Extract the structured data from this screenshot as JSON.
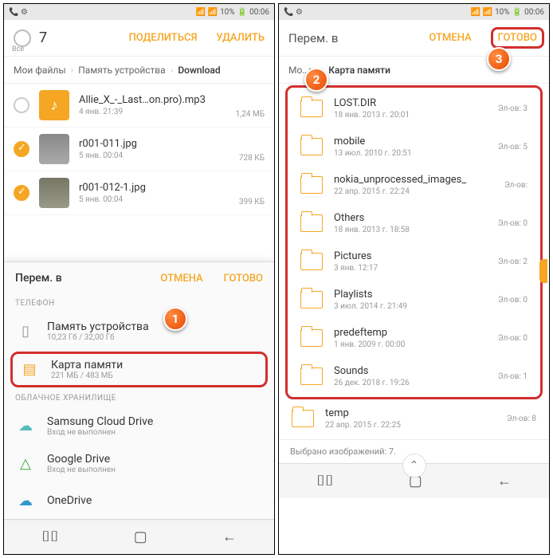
{
  "status": {
    "batt": "10%",
    "time": "00:06"
  },
  "p1": {
    "count": "7",
    "all": "Все",
    "share": "ПОДЕЛИТЬСЯ",
    "delete": "УДАЛИТЬ",
    "crumb1": "Мои файлы",
    "crumb2": "Память устройства",
    "crumb3": "Download",
    "files": [
      {
        "name": "Allie_X_-_Last…on.pro).mp3",
        "date": "4 янв. 21:39",
        "size": "1,24 МБ",
        "type": "music",
        "checked": false
      },
      {
        "name": "r001-011.jpg",
        "date": "5 янв. 00:04",
        "size": "728 КБ",
        "type": "img",
        "checked": true
      },
      {
        "name": "r001-012-1.jpg",
        "date": "5 янв. 00:04",
        "size": "399 КБ",
        "type": "img",
        "checked": true
      }
    ],
    "sheet": {
      "title": "Перем. в",
      "cancel": "ОТМЕНА",
      "done": "ГОТОВО",
      "cat1": "ТЕЛЕФОН",
      "cat2": "ОБЛАЧНОЕ ХРАНИЛИЩЕ",
      "storages": [
        {
          "name": "Память устройства",
          "sub": "10,23 Гб / 32,00 Гб",
          "icon": "▢"
        },
        {
          "name": "Карта памяти",
          "sub": "221 МБ / 483 МБ",
          "icon": "▤"
        }
      ],
      "clouds": [
        {
          "name": "Samsung Cloud Drive",
          "sub": "Вход не выполнен",
          "icon": "☁"
        },
        {
          "name": "Google Drive",
          "sub": "Вход не выполнен",
          "icon": "△"
        },
        {
          "name": "OneDrive",
          "sub": "",
          "icon": "☁"
        }
      ]
    }
  },
  "p2": {
    "title": "Перем. в",
    "cancel": "ОТМЕНА",
    "done": "ГОТОВО",
    "crumb1": "Мо…ы",
    "crumb2": "Карта памяти",
    "folders": [
      {
        "name": "LOST.DIR",
        "date": "18 янв. 2013 г. 20:01",
        "count": "Эл-ов: 3"
      },
      {
        "name": "mobile",
        "date": "13 июл. 2010 г. 20:51",
        "count": "Эл-ов: 5"
      },
      {
        "name": "nokia_unprocessed_images_",
        "date": "22 апр. 2015 г. 22:24",
        "count": "Эл-ов:"
      },
      {
        "name": "Others",
        "date": "18 янв. 2013 г. 18:58",
        "count": "Эл-ов: 0"
      },
      {
        "name": "Pictures",
        "date": "3 янв. 12:17",
        "count": "Эл-ов: 2"
      },
      {
        "name": "Playlists",
        "date": "3 июл. 2014 г. 21:49",
        "count": "Эл-ов: 0"
      },
      {
        "name": "predeftemp",
        "date": "1 янв. 2009 г. 00:00",
        "count": "Эл-ов: 0"
      },
      {
        "name": "Sounds",
        "date": "26 дек. 2018 г. 19:26",
        "count": "Эл-ов: 1"
      }
    ],
    "extra": {
      "name": "temp",
      "date": "22 апр. 2015 г. 22:25",
      "count": "Эл-ов: 8"
    },
    "footer": "Выбрано изображений: 7."
  }
}
